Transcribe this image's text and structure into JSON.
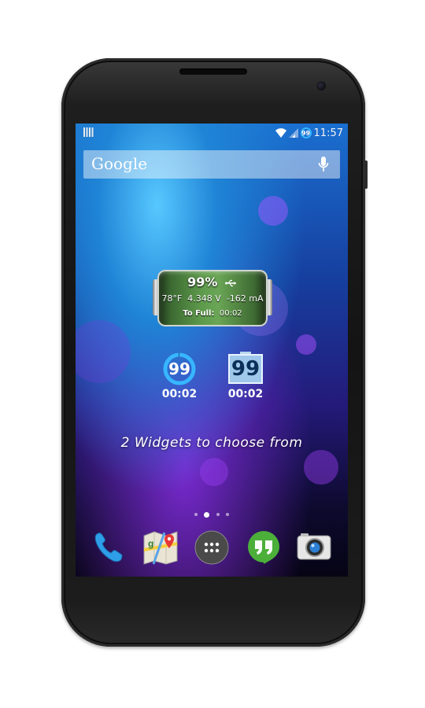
{
  "status_bar": {
    "clock": "11:57",
    "battery_badge": "99"
  },
  "search": {
    "logo_text": "Google"
  },
  "battery_widget": {
    "percent": "99%",
    "temperature": "78°F",
    "voltage": "4.348 V",
    "current": "-162 mA",
    "to_full_label": "To Full:",
    "to_full_time": "00:02"
  },
  "ring_widget": {
    "level": "99",
    "time": "00:02",
    "progress_fraction": 0.99
  },
  "box_widget": {
    "level": "99",
    "time": "00:02"
  },
  "caption": "2 Widgets to choose from",
  "home_pages": {
    "count": 4,
    "active_index": 1
  },
  "dock": [
    "phone-icon",
    "maps-icon",
    "app-drawer-icon",
    "hangouts-icon",
    "camera-icon"
  ],
  "colors": {
    "ring_accent": "#37b6ff",
    "battery_green": "#5e9a4c",
    "hangouts_green": "#4caf3a"
  }
}
